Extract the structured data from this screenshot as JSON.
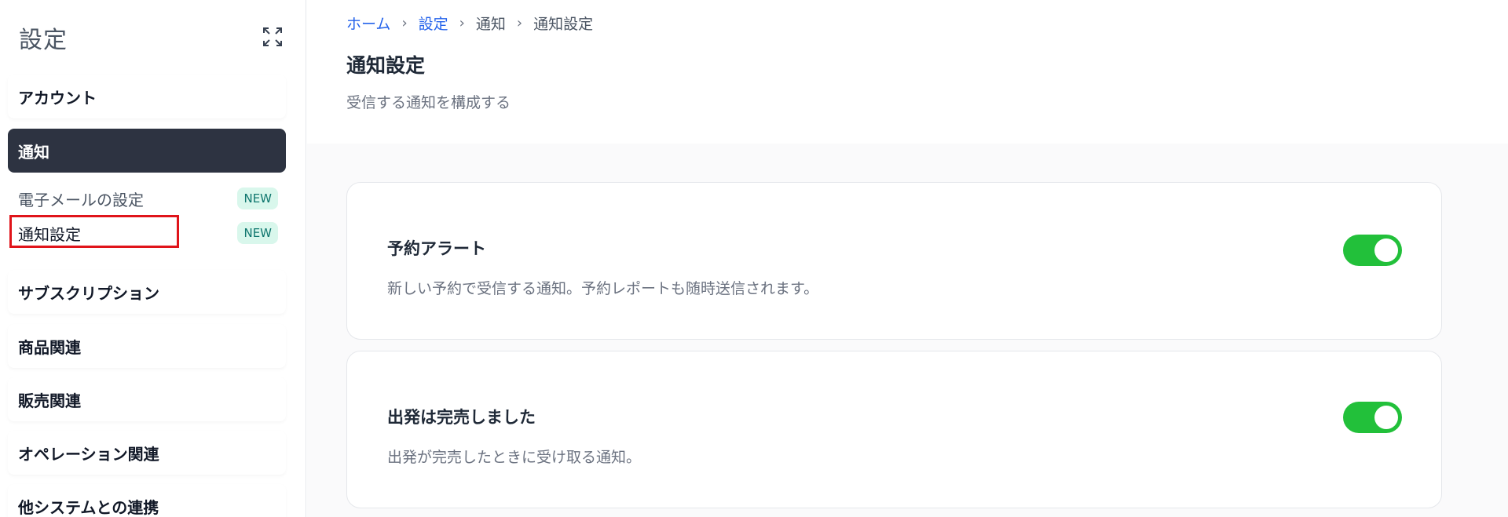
{
  "sidebar": {
    "title": "設定",
    "expand_icon": "expand-icon",
    "items": [
      {
        "label": "アカウント"
      },
      {
        "label": "通知",
        "active": true
      },
      {
        "label": "サブスクリプション"
      },
      {
        "label": "商品関連"
      },
      {
        "label": "販売関連"
      },
      {
        "label": "オペレーション関連"
      },
      {
        "label": "他システムとの連携"
      }
    ],
    "sub_items": [
      {
        "label": "電子メールの設定",
        "badge": "NEW"
      },
      {
        "label": "通知設定",
        "badge": "NEW",
        "current": true
      }
    ]
  },
  "breadcrumb": [
    "ホーム",
    "設定",
    "通知",
    "通知設定"
  ],
  "page": {
    "title": "通知設定",
    "subtitle": "受信する通知を構成する"
  },
  "cards": [
    {
      "title": "予約アラート",
      "description": "新しい予約で受信する通知。予約レポートも随時送信されます。",
      "enabled": true
    },
    {
      "title": "出発は完売しました",
      "description": "出発が完売したときに受け取る通知。",
      "enabled": true
    }
  ],
  "colors": {
    "active_menu_bg": "#2d3341",
    "toggle_on": "#22c03a",
    "link": "#2563eb",
    "badge_bg": "#d9f7ec",
    "highlight": "#e0141a"
  }
}
